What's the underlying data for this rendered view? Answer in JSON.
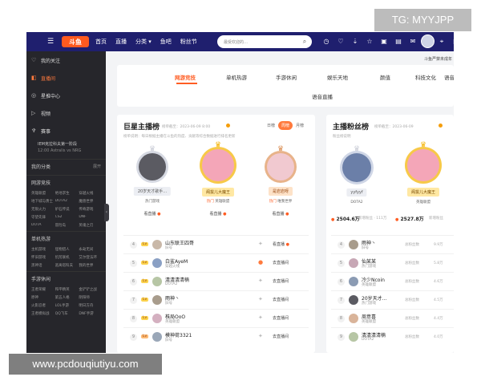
{
  "overlay": {
    "tg": "TG: MYYJPP",
    "site": "www.pcdouqiutiyu.com"
  },
  "header": {
    "logo": "斗鱼",
    "nav": [
      "首页",
      "直播",
      "分类 ▾",
      "鱼吧",
      "粉丝节"
    ],
    "search_placeholder": "最受欢迎的…",
    "icons": [
      "clock-icon",
      "heart-icon",
      "download-icon",
      "follow-icon",
      "video-icon",
      "wallet-icon",
      "chat-icon",
      "bulb-icon",
      "location-icon",
      "task-icon"
    ],
    "promo": "斗鱼严禁未成年"
  },
  "sidebar": {
    "items": [
      {
        "icon": "heart-icon",
        "label": "我的关注"
      },
      {
        "icon": "live-icon",
        "label": "直播间",
        "active": true
      },
      {
        "icon": "star-icon",
        "label": "星推中心"
      },
      {
        "icon": "video-icon",
        "label": "视频"
      },
      {
        "icon": "trophy-icon",
        "label": "赛事"
      }
    ],
    "match": {
      "title": "IEM克拉科夫第一阶段",
      "sub": "12:00 Astralis vs NRG"
    },
    "sections": [
      {
        "title": "我的分类",
        "more": "展开",
        "items": []
      },
      {
        "title": "网游竞技",
        "more": "",
        "items": [
          "英雄联盟",
          "绝地求生",
          "穿越火线",
          "地下城与勇士",
          "DOTA2",
          "魔兽世界",
          "无限火力",
          "炉石传说",
          "传奇游戏",
          "守望先锋",
          "CS2",
          "DNF",
          "DOTA",
          "冒险岛",
          "英魂之刃"
        ]
      },
      {
        "title": "单机热游",
        "more": "",
        "items": [
          "主机游戏",
          "怪物猎人",
          "永劫无间",
          "怀旧游戏",
          "饥荒联机",
          "艾尔登法环",
          "黑神话",
          "逃离塔科夫",
          "我的世界"
        ]
      },
      {
        "title": "手游休闲",
        "more": "",
        "items": [
          "王者荣耀",
          "和平精英",
          "金铲铲之战",
          "原神",
          "第五人格",
          "阴阳师",
          "火影忍者",
          "LOL手游",
          "明日方舟",
          "王者模拟战",
          "QQ飞车",
          "DNF手游"
        ]
      }
    ]
  },
  "category_tabs": {
    "row1": [
      "网游竞技",
      "单机热游",
      "手游休闲",
      "娱乐天地",
      "颜值",
      "科技文化",
      "语音"
    ],
    "row2": [
      "语音直播"
    ],
    "active_index": 0
  },
  "left_panel": {
    "title": "巨星主播榜",
    "stamp": "榜单截至：2023-06-09 8:00",
    "subtitle": "榜单说明：每日根据主播在斗鱼的热度、贡献等综合数据进行排名更新",
    "toggle": [
      "日榜",
      "周榜",
      "月榜"
    ],
    "toggle_active": 1,
    "top3": [
      {
        "rank": 2,
        "name": "20岁天才歌手…",
        "tags": [
          "热门游戏"
        ],
        "button": "看直播",
        "hot": false
      },
      {
        "rank": 1,
        "name": "阁拔儿大魔王",
        "tags": [
          "热门",
          "英雄联盟"
        ],
        "button": "看直播",
        "hot": true
      },
      {
        "rank": 3,
        "name": "是岩岩呀",
        "tags": [
          "热门",
          "唯我世界"
        ],
        "button": "看直播",
        "hot": true
      }
    ],
    "rows": [
      {
        "rank": "4",
        "name": "山东联王四哥",
        "cat": "旧号",
        "button": "看直播",
        "live": false
      },
      {
        "rank": "5",
        "name": "白鲨AyeM",
        "cat": "穿越火线",
        "button": "去直播间",
        "live": true
      },
      {
        "rank": "6",
        "name": "清清清清楠",
        "cat": "DOTA2",
        "button": "去直播间",
        "live": false
      },
      {
        "rank": "7",
        "name": "雨神丶",
        "cat": "旧号",
        "button": "去直播间",
        "live": false
      },
      {
        "rank": "8",
        "name": "株局OoO",
        "cat": "英雄联盟",
        "button": "去直播间",
        "live": false
      },
      {
        "rank": "9",
        "name": "模神荷3321",
        "cat": "旧号",
        "button": "去直播间",
        "live": false
      }
    ]
  },
  "right_panel": {
    "title": "主播粉丝榜",
    "stamp": "榜单截至：2023-06-09",
    "subtitle": "粉丝榜说明",
    "top2": [
      {
        "name": "yyfyyf",
        "tags": [
          "DOTA2"
        ],
        "count": "2504.6万",
        "sub": "新增粉丝 · 111万"
      },
      {
        "name": "阁拔儿大魔王",
        "tags": [
          "英雄联盟"
        ],
        "count": "2527.8万",
        "sub": "新增粉丝"
      }
    ],
    "rows": [
      {
        "rank": "4",
        "name": "雨神丶",
        "cat": "旧号",
        "label": "总粉丝数",
        "value": "9.9万"
      },
      {
        "rank": "5",
        "name": "仙某某",
        "cat": "热门游戏",
        "label": "总粉丝数",
        "value": "5.8万"
      },
      {
        "rank": "6",
        "name": "冷少Ncoin",
        "cat": "英雄联盟",
        "label": "总粉丝数",
        "value": "4.6万"
      },
      {
        "rank": "7",
        "name": "20岁天才…",
        "cat": "热门游戏",
        "label": "总粉丝数",
        "value": "4.5万"
      },
      {
        "rank": "8",
        "name": "周意喜",
        "cat": "英雄联盟",
        "label": "总粉丝数",
        "value": "4.4万"
      },
      {
        "rank": "9",
        "name": "清清清清楠",
        "cat": "DOTA2",
        "label": "总粉丝数",
        "value": "4.0万"
      }
    ]
  },
  "colors": {
    "accent": "#ff5d23",
    "header": "#1f1f6e",
    "sidebar": "#26262b"
  }
}
